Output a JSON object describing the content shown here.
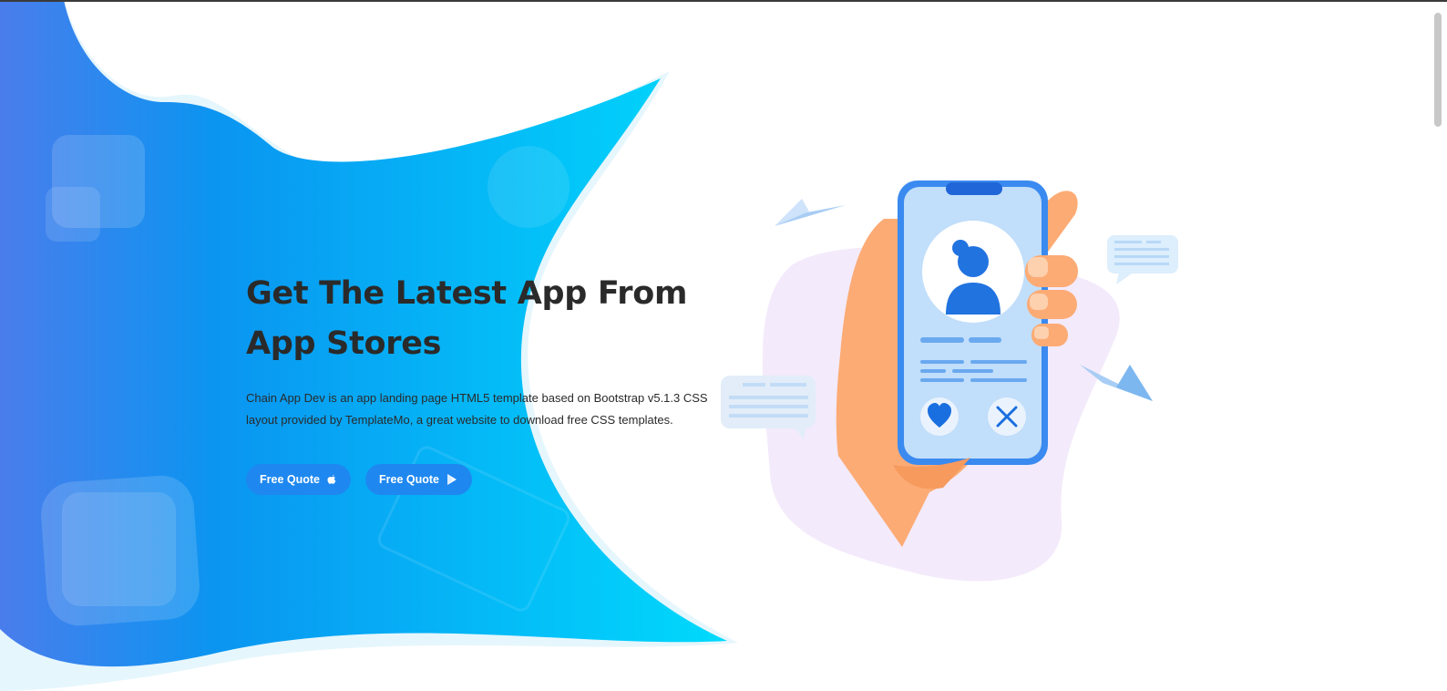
{
  "hero": {
    "title": "Get The Latest App From App Stores",
    "description": "Chain App Dev is an app landing page HTML5 template based on Bootstrap v5.1.3 CSS layout provided by TemplateMo, a great website to download free CSS templates.",
    "buttons": [
      {
        "label": "Free Quote",
        "icon": "apple-icon"
      },
      {
        "label": "Free Quote",
        "icon": "google-play-icon"
      }
    ]
  },
  "colors": {
    "gradient_start": "#4b7bec",
    "gradient_mid": "#0b93f0",
    "gradient_end": "#00d4fa",
    "button": "#1e88f0",
    "title": "#2a2a2a",
    "illustration_blob": "#f3eafb"
  }
}
